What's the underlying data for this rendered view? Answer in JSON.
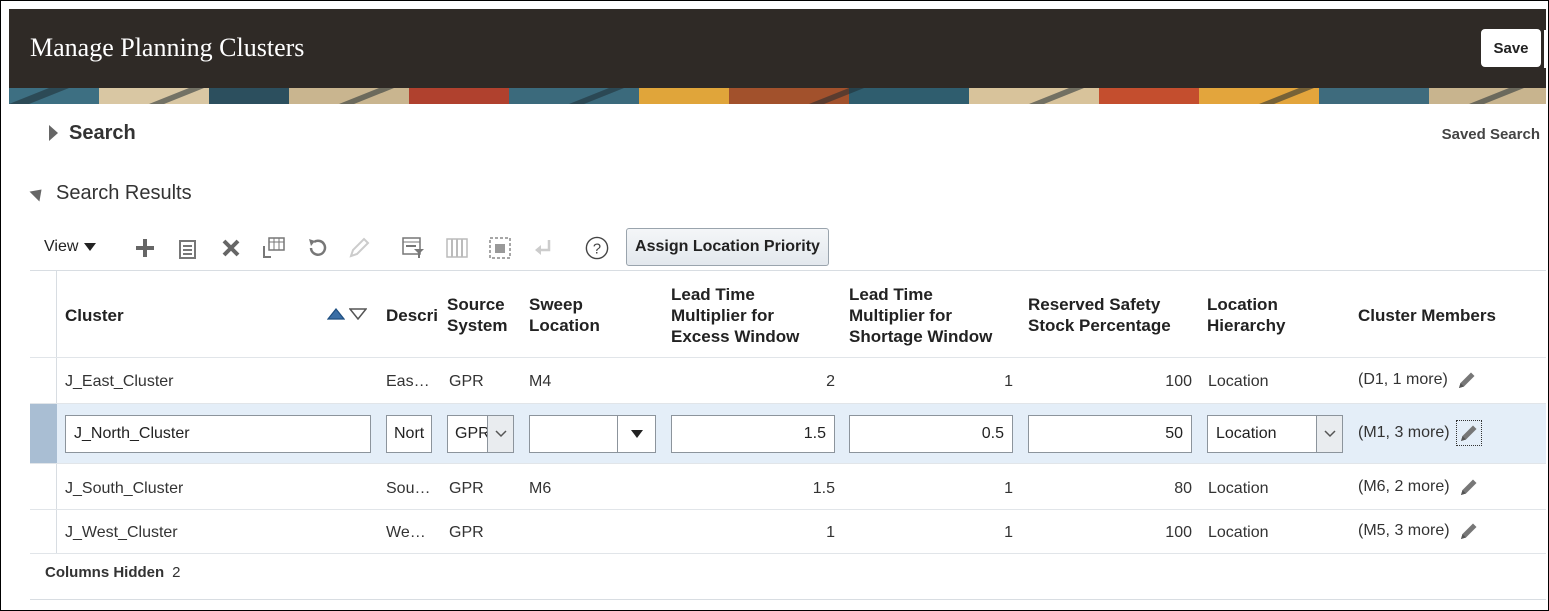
{
  "header": {
    "title": "Manage Planning Clusters",
    "save_label": "Save"
  },
  "search": {
    "label": "Search",
    "saved_search_label": "Saved Search"
  },
  "results": {
    "label": "Search Results"
  },
  "toolbar": {
    "view_label": "View",
    "icons": [
      "add-icon",
      "duplicate-icon",
      "delete-icon",
      "export-icon",
      "refresh-icon",
      "edit-icon",
      "query-by-example-icon",
      "freeze-icon",
      "detach-icon",
      "wrap-icon",
      "help-icon"
    ],
    "assign_label": "Assign Location Priority"
  },
  "table": {
    "headers": {
      "cluster": "Cluster",
      "description": "Descri",
      "source_system": [
        "Source",
        "System"
      ],
      "sweep_location": [
        "Sweep",
        "Location"
      ],
      "lead_excess": [
        "Lead Time",
        "Multiplier for",
        "Excess Window"
      ],
      "lead_shortage": [
        "Lead Time",
        "Multiplier for",
        "Shortage Window"
      ],
      "safety_stock": [
        "Reserved Safety",
        "Stock Percentage"
      ],
      "location_hierarchy": [
        "Location",
        "Hierarchy"
      ],
      "cluster_members": "Cluster Members"
    },
    "rows": [
      {
        "cluster": "J_East_Cluster",
        "description": "Eas…",
        "source_system": "GPR",
        "sweep_location": "M4",
        "lead_excess": "2",
        "lead_shortage": "1",
        "safety_stock": "100",
        "location_hierarchy": "Location",
        "cluster_members": "(D1, 1 more)"
      },
      {
        "cluster": "J_North_Cluster",
        "description": "Nort",
        "source_system": "GPR",
        "sweep_location": "",
        "lead_excess": "1.5",
        "lead_shortage": "0.5",
        "safety_stock": "50",
        "location_hierarchy": "Location",
        "cluster_members": "(M1, 3 more)"
      },
      {
        "cluster": "J_South_Cluster",
        "description": "Sou…",
        "source_system": "GPR",
        "sweep_location": "M6",
        "lead_excess": "1.5",
        "lead_shortage": "1",
        "safety_stock": "80",
        "location_hierarchy": "Location",
        "cluster_members": "(M6, 2 more)"
      },
      {
        "cluster": "J_West_Cluster",
        "description": "We…",
        "source_system": "GPR",
        "sweep_location": "",
        "lead_excess": "1",
        "lead_shortage": "1",
        "safety_stock": "100",
        "location_hierarchy": "Location",
        "cluster_members": "(M5, 3 more)"
      }
    ]
  },
  "footer": {
    "columns_hidden_label": "Columns Hidden",
    "columns_hidden_count": "2"
  },
  "colors": {
    "header_bg": "#2f2a26",
    "selected_row_bg": "#e4eef8",
    "selected_row_marker": "#a9bed3",
    "sort_asc": "#3a6ea5"
  }
}
